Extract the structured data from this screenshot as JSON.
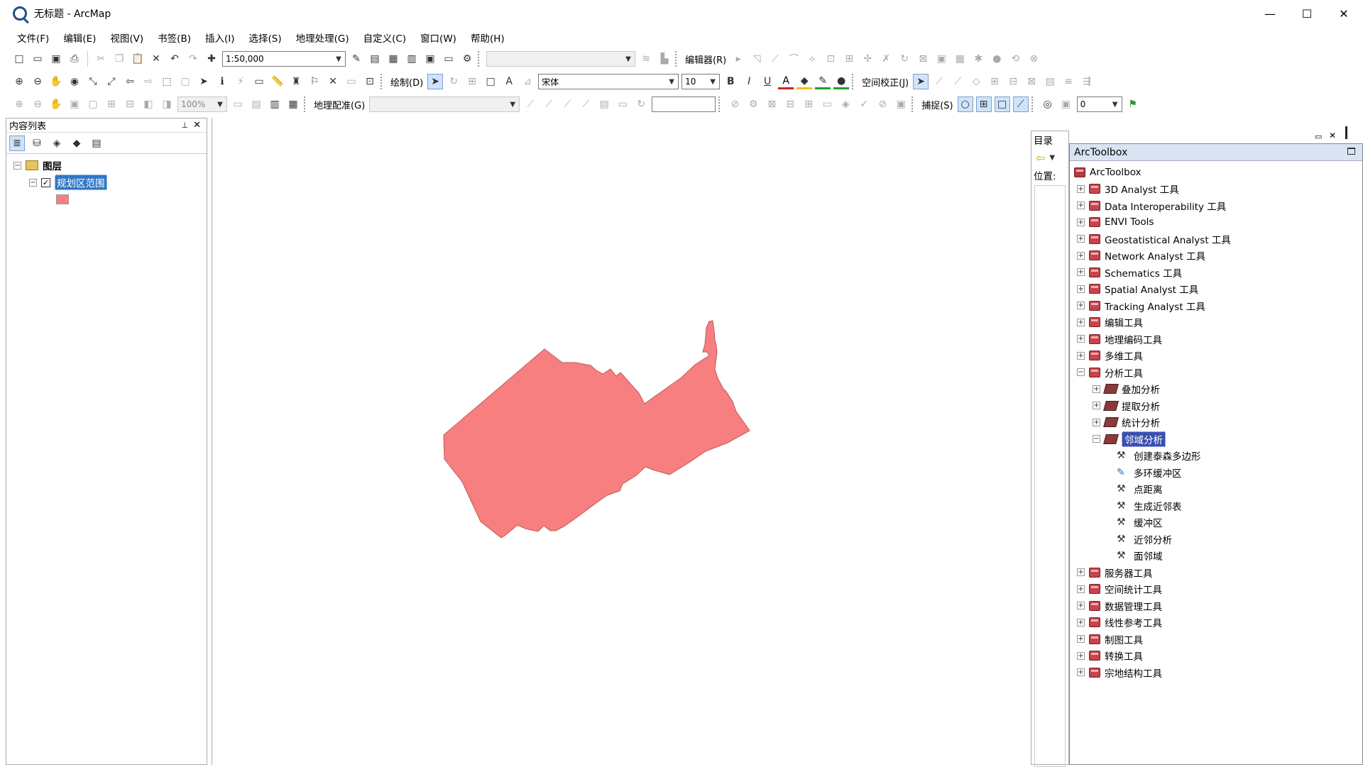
{
  "window": {
    "title": "无标题 - ArcMap",
    "minimize": "—",
    "maximize": "☐",
    "close": "✕"
  },
  "menu": [
    "文件(F)",
    "编辑(E)",
    "视图(V)",
    "书签(B)",
    "插入(I)",
    "选择(S)",
    "地理处理(G)",
    "自定义(C)",
    "窗口(W)",
    "帮助(H)"
  ],
  "toolbar1": {
    "scale": "1:50,000",
    "editor_label": "编辑器(R)"
  },
  "toolbar2": {
    "draw_label": "绘制(D)",
    "font": "宋体",
    "font_size": "10",
    "bold": "B",
    "italic": "I",
    "underline": "U",
    "spatial_adjust": "空间校正(J)"
  },
  "toolbar3": {
    "zoom": "100%",
    "georef_label": "地理配准(G)",
    "snap_label": "捕捉(S)",
    "snap_value": "0"
  },
  "toc": {
    "title": "内容列表",
    "layers_group": "图层",
    "layer_name": "规划区范围",
    "symbol_color": "#f77f7f"
  },
  "catalog": {
    "title": "目录",
    "location_label": "位置:"
  },
  "toolbox": {
    "title": "ArcToolbox",
    "root": "ArcToolbox",
    "items": [
      {
        "label": "3D Analyst 工具",
        "level": 0,
        "type": "toolbox",
        "exp": "+"
      },
      {
        "label": "Data Interoperability 工具",
        "level": 0,
        "type": "toolbox",
        "exp": "+"
      },
      {
        "label": "ENVI Tools",
        "level": 0,
        "type": "toolbox",
        "exp": "+"
      },
      {
        "label": "Geostatistical Analyst 工具",
        "level": 0,
        "type": "toolbox",
        "exp": "+"
      },
      {
        "label": "Network Analyst 工具",
        "level": 0,
        "type": "toolbox",
        "exp": "+"
      },
      {
        "label": "Schematics 工具",
        "level": 0,
        "type": "toolbox",
        "exp": "+"
      },
      {
        "label": "Spatial Analyst 工具",
        "level": 0,
        "type": "toolbox",
        "exp": "+"
      },
      {
        "label": "Tracking Analyst 工具",
        "level": 0,
        "type": "toolbox",
        "exp": "+"
      },
      {
        "label": "编辑工具",
        "level": 0,
        "type": "toolbox",
        "exp": "+"
      },
      {
        "label": "地理编码工具",
        "level": 0,
        "type": "toolbox",
        "exp": "+"
      },
      {
        "label": "多维工具",
        "level": 0,
        "type": "toolbox",
        "exp": "+"
      },
      {
        "label": "分析工具",
        "level": 0,
        "type": "toolbox",
        "exp": "−"
      },
      {
        "label": "叠加分析",
        "level": 1,
        "type": "toolset",
        "exp": "+"
      },
      {
        "label": "提取分析",
        "level": 1,
        "type": "toolset",
        "exp": "+"
      },
      {
        "label": "统计分析",
        "level": 1,
        "type": "toolset",
        "exp": "+"
      },
      {
        "label": "邻域分析",
        "level": 1,
        "type": "toolset",
        "exp": "−",
        "selected": true
      },
      {
        "label": "创建泰森多边形",
        "level": 2,
        "type": "tool"
      },
      {
        "label": "多环缓冲区",
        "level": 2,
        "type": "script"
      },
      {
        "label": "点距离",
        "level": 2,
        "type": "tool"
      },
      {
        "label": "生成近邻表",
        "level": 2,
        "type": "tool"
      },
      {
        "label": "缓冲区",
        "level": 2,
        "type": "tool"
      },
      {
        "label": "近邻分析",
        "level": 2,
        "type": "tool"
      },
      {
        "label": "面邻域",
        "level": 2,
        "type": "tool"
      },
      {
        "label": "服务器工具",
        "level": 0,
        "type": "toolbox",
        "exp": "+"
      },
      {
        "label": "空间统计工具",
        "level": 0,
        "type": "toolbox",
        "exp": "+"
      },
      {
        "label": "数据管理工具",
        "level": 0,
        "type": "toolbox",
        "exp": "+"
      },
      {
        "label": "线性参考工具",
        "level": 0,
        "type": "toolbox",
        "exp": "+"
      },
      {
        "label": "制图工具",
        "level": 0,
        "type": "toolbox",
        "exp": "+"
      },
      {
        "label": "转换工具",
        "level": 0,
        "type": "toolbox",
        "exp": "+"
      },
      {
        "label": "宗地结构工具",
        "level": 0,
        "type": "toolbox",
        "exp": "+"
      }
    ]
  },
  "map": {
    "polygon_fill": "#f77f7f",
    "polygon_stroke": "#c05a5a"
  }
}
